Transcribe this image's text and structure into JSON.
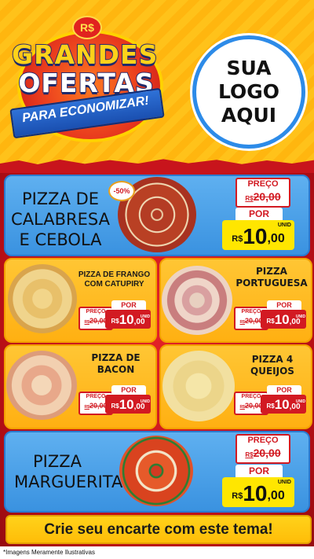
{
  "header": {
    "currency_badge": "R$",
    "title_line1": "GRANDES",
    "title_line2": "OFERTAS",
    "ribbon": "PARA ECONOMIZAR!",
    "logo_lines": [
      "SUA",
      "LOGO",
      "AQUI"
    ]
  },
  "labels": {
    "preco": "PREÇO",
    "por": "POR",
    "currency": "R$",
    "unid": "UNID"
  },
  "products": [
    {
      "name_lines": [
        "PIZZA DE",
        "CALABRESA",
        "E CEBOLA"
      ],
      "old_price": "20,00",
      "new_int": "10",
      "new_dec": ",00",
      "discount": "-50%"
    },
    {
      "name_lines": [
        "PIZZA DE FRANGO",
        "COM CATUPIRY"
      ],
      "old_price": "20,00",
      "new_int": "10",
      "new_dec": ",00"
    },
    {
      "name_lines": [
        "PIZZA",
        "PORTUGUESA"
      ],
      "old_price": "20,00",
      "new_int": "10",
      "new_dec": ",00"
    },
    {
      "name_lines": [
        "PIZZA DE",
        "BACON"
      ],
      "old_price": "20,00",
      "new_int": "10",
      "new_dec": ",00"
    },
    {
      "name_lines": [
        "PIZZA 4",
        "QUEIJOS"
      ],
      "old_price": "20,00",
      "new_int": "10",
      "new_dec": ",00"
    },
    {
      "name_lines": [
        "PIZZA",
        "MARGUERITA"
      ],
      "old_price": "20,00",
      "new_int": "10",
      "new_dec": ",00"
    }
  ],
  "cta": "Crie seu encarte com este tema!",
  "disclaimer": "*Imagens Meramente Ilustrativas",
  "colors": {
    "header_yellow": "#ffc21a",
    "red": "#c8141c",
    "blue_card": "#4aa0e8",
    "yellow_card": "#ffbd1f",
    "price_red": "#d21a22",
    "price_yellow": "#ffe600"
  }
}
